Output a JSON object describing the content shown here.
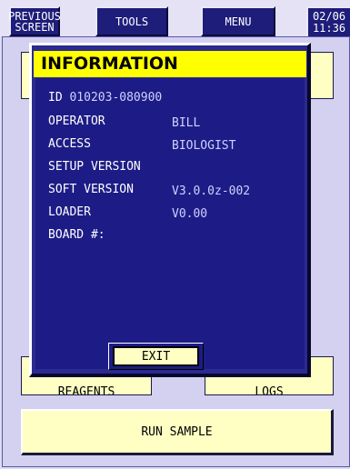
{
  "topbar": {
    "previous_line1": "PREVIOUS",
    "previous_line2": "SCREEN",
    "tools": "TOOLS",
    "menu": "MENU",
    "date_line1": "02/06",
    "date_line2": "11:36"
  },
  "background": {
    "left_button_label": "REAGENTS",
    "right_button_label": "LOGS",
    "run_sample": "RUN SAMPLE"
  },
  "dialog": {
    "title": "INFORMATION",
    "id_label": "ID",
    "id_value": "010203-080900",
    "rows": [
      {
        "label": "OPERATOR",
        "value": "BILL"
      },
      {
        "label": "ACCESS",
        "value": "BIOLOGIST"
      },
      {
        "label": "SETUP VERSION",
        "value": ""
      },
      {
        "label": "SOFT VERSION",
        "value": "V3.0.0z-002"
      },
      {
        "label": "LOADER",
        "value": "V0.00"
      },
      {
        "label": "BOARD #:",
        "value": ""
      }
    ],
    "exit": "EXIT"
  },
  "colors": {
    "title_bar": "#ffff00",
    "dialog_bg": "#1d1c86",
    "button_yellow": "#ffffc4",
    "toolbar_button": "#1e1d7a"
  }
}
